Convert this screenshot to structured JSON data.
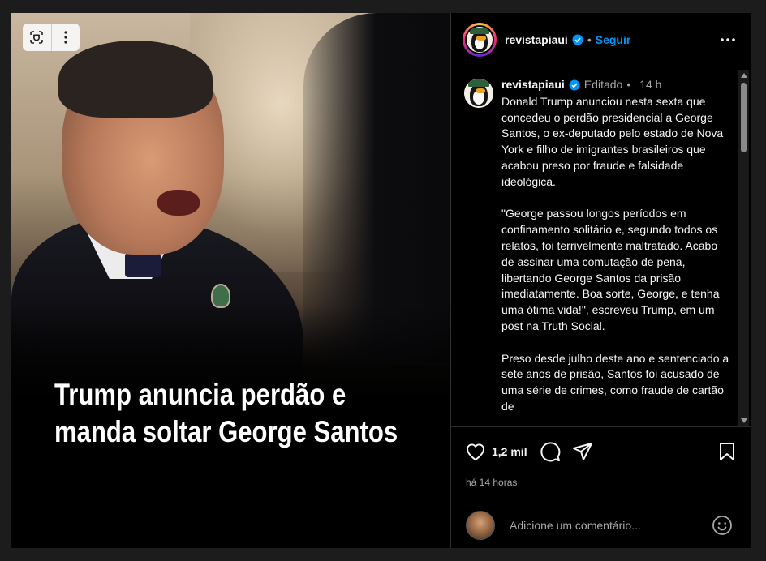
{
  "post": {
    "headline_line1": "Trump anuncia perdão e",
    "headline_line2": "manda soltar George Santos"
  },
  "header": {
    "username": "revistapiaui",
    "separator": "•",
    "follow_label": "Seguir"
  },
  "caption": {
    "username": "revistapiaui",
    "edited": "Editado",
    "separator": "•",
    "time": "14 h",
    "paragraphs": [
      "Donald Trump anunciou nesta sexta que concedeu o perdão presidencial a George Santos, o ex-deputado pelo estado de Nova York e filho de imigrantes brasileiros que acabou preso por fraude e falsidade ideológica.",
      "\"George passou longos períodos em confinamento solitário e, segundo todos os relatos, foi terrivelmente maltratado. Acabo de assinar uma comutação de pena, libertando George Santos da prisão imediatamente. Boa sorte, George, e tenha uma ótima vida!\", escreveu Trump, em um post na Truth Social.",
      "Preso desde julho deste ano e sentenciado a sete anos de prisão, Santos foi acusado de uma série de crimes, como fraude de cartão de"
    ]
  },
  "actions": {
    "likes": "1,2 mil",
    "time_ago": "há 14 horas"
  },
  "comment": {
    "placeholder": "Adicione um comentário..."
  },
  "icons": {
    "media_tools": [
      "lens-icon",
      "more-vertical-icon"
    ],
    "header": [
      "verified-badge-icon",
      "more-horizontal-icon"
    ],
    "actions": [
      "heart-icon",
      "comment-icon",
      "share-icon",
      "bookmark-icon"
    ],
    "comment": [
      "emoji-icon"
    ]
  },
  "colors": {
    "background": "#000000",
    "accent_blue": "#0095f6",
    "text_primary": "#f5f5f5",
    "text_secondary": "#a8a8a8"
  }
}
